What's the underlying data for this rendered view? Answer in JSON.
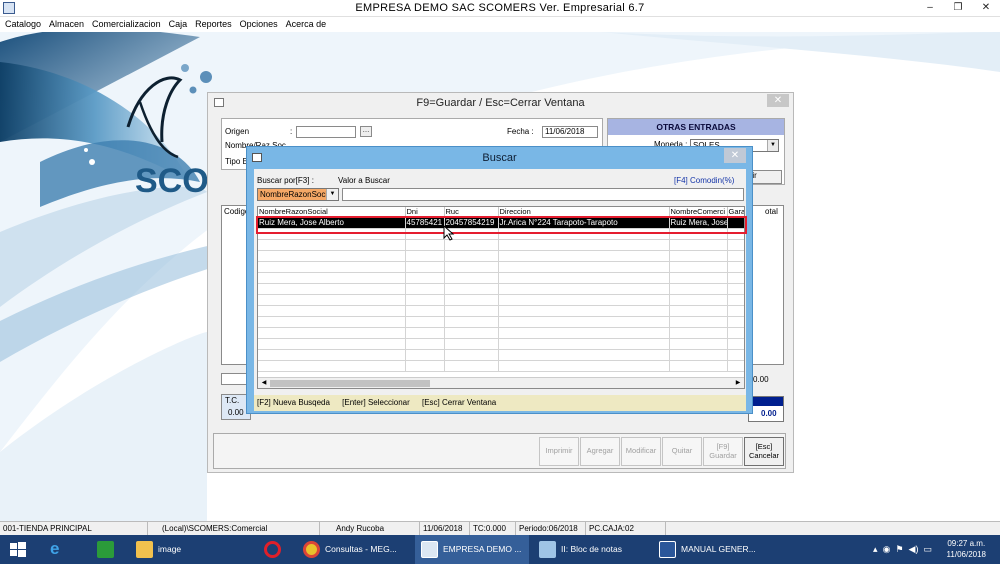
{
  "window": {
    "title": "EMPRESA DEMO SAC        SCOMERS Ver. Empresarial  6.7",
    "minimize": "–",
    "restore": "❐",
    "close": "✕"
  },
  "menu": [
    "Catalogo",
    "Almacen",
    "Comercializacion",
    "Caja",
    "Reportes",
    "Opciones",
    "Acerca de"
  ],
  "logo": {
    "text": "SCOM"
  },
  "form": {
    "title": "F9=Guardar / Esc=Cerrar Ventana",
    "origen_label": "Origen",
    "colon": ":",
    "nombre_label": "Nombre/Raz.Soc.",
    "tipo_label": "Tipo E",
    "fecha_label": "Fecha :",
    "fecha_value": "11/06/2018",
    "otras_title": "OTRAS ENTRADAS",
    "moneda_label": "Moneda :",
    "moneda_value": "SOLES",
    "distribuir": "ribuir",
    "codigo_col": "Codigo",
    "total_col": "otal",
    "tc_label": "T.C.",
    "tc_value": "0.00",
    "sum_value": "0.00",
    "total_value": "0.00",
    "buttons": [
      {
        "label": "Imprimir",
        "enabled": false
      },
      {
        "label": "Agregar",
        "enabled": false
      },
      {
        "label": "Modificar",
        "enabled": false
      },
      {
        "label": "Quitar",
        "enabled": false
      },
      {
        "label": "[F9] Guardar",
        "enabled": false
      },
      {
        "label": "[Esc] Cancelar",
        "enabled": true
      }
    ]
  },
  "buscar": {
    "title": "Buscar",
    "buscar_por_label": "Buscar por[F3] :",
    "valor_label": "Valor a Buscar",
    "comodin": "[F4] Comodin(%)",
    "field_selected": "NombreRazonSoci",
    "columns": [
      "NombreRazonSocial",
      "Dni",
      "Ruc",
      "Direccion",
      "NombreComerci",
      "Gara"
    ],
    "rows": [
      [
        "Ruiz Mera, Jose Alberto",
        "45785421",
        "20457854219",
        "Jr.Arica N°224 Tarapoto-Tarapoto",
        "Ruiz Mera, Jose",
        ""
      ]
    ],
    "footer": [
      "[F2] Nueva Busqeda",
      "[Enter] Seleccionar",
      "[Esc] Cerrar Ventana"
    ]
  },
  "status": [
    "001-TIENDA PRINCIPAL",
    "(Local)\\SCOMERS:Comercial",
    "Andy Rucoba",
    "11/06/2018",
    "TC:0.000",
    "Periodo:06/2018",
    "PC.CAJA:02"
  ],
  "taskbar": {
    "items": [
      "image",
      "Consultas - MEG...",
      "EMPRESA DEMO ...",
      "II: Bloc de notas",
      "MANUAL GENER..."
    ],
    "time": "09:27 a.m.",
    "date": "11/06/2018"
  },
  "colors": {
    "dialog_frame": "#79b7e6",
    "highlight": "#e51d2f",
    "otras_header": "#a7b4e2",
    "taskbar": "#1c3f73"
  }
}
